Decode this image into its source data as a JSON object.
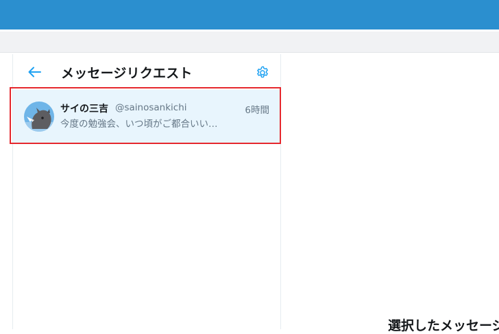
{
  "colors": {
    "accent": "#1da1f2",
    "topbar": "#2b8fcf",
    "highlight_border": "#e5272d",
    "row_bg": "#e8f5fd"
  },
  "header": {
    "back_icon": "arrow-left-icon",
    "title": "メッセージリクエスト",
    "settings_icon": "gear-icon"
  },
  "conversations": [
    {
      "name": "サイの三吉",
      "handle": "@sainosankichi",
      "time": "6時間",
      "preview": "今度の勉強会、いつ頃がご都合いい…",
      "avatar_icon": "rhino-avatar"
    }
  ],
  "main": {
    "empty_title": "選択したメッセージ"
  }
}
